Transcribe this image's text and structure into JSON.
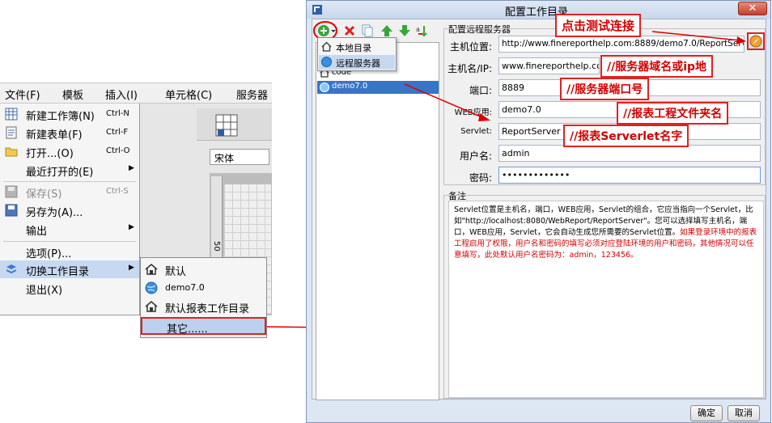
{
  "menubar": {
    "items": [
      {
        "label": "文件(F)"
      },
      {
        "label": "模板"
      },
      {
        "label": "插入(I)"
      },
      {
        "label": "单元格(C)"
      },
      {
        "label": "服务器"
      }
    ]
  },
  "file_menu": {
    "items": [
      {
        "label": "新建工作簿(N)",
        "shortcut": "Ctrl-N",
        "icon": "new-workbook-icon"
      },
      {
        "label": "新建表单(F)",
        "shortcut": "Ctrl-F",
        "icon": "new-form-icon"
      },
      {
        "label": "打开...(O)",
        "shortcut": "Ctrl-O",
        "icon": "folder-icon"
      },
      {
        "label": "最近打开的(E)",
        "shortcut": "",
        "icon": ""
      },
      {
        "label": "保存(S)",
        "shortcut": "Ctrl-S",
        "icon": "save-icon"
      },
      {
        "label": "另存为(A)...",
        "shortcut": "",
        "icon": "save-as-icon"
      },
      {
        "label": "输出",
        "shortcut": "",
        "icon": ""
      },
      {
        "label": "选项(P)...",
        "shortcut": "",
        "icon": ""
      },
      {
        "label": "切换工作目录",
        "shortcut": "",
        "icon": "switch-directory-icon"
      },
      {
        "label": "退出(X)",
        "shortcut": "",
        "icon": ""
      }
    ]
  },
  "editor": {
    "font_value": "宋体",
    "ruler_label": "50"
  },
  "switch_submenu": {
    "items": [
      {
        "label": "默认",
        "icon": "home-icon"
      },
      {
        "label": "demo7.0",
        "icon": "globe-icon"
      },
      {
        "label": "默认报表工作目录",
        "icon": "home-icon"
      },
      {
        "label": "其它......",
        "icon": ""
      }
    ]
  },
  "dialog": {
    "title": "配置工作目录",
    "add_dropdown": [
      {
        "label": "本地目录",
        "icon": "home-icon"
      },
      {
        "label": "远程服务器",
        "icon": "globe-icon"
      }
    ],
    "tree": [
      {
        "label": "code",
        "icon": "home-icon"
      },
      {
        "label": "demo7.0",
        "icon": "globe-icon"
      }
    ],
    "group_title": "配置远程服务器",
    "fields": {
      "host_position": {
        "label": "主机位置:",
        "value": "http://www.finereporthelp.com:8889/demo7.0/ReportServer"
      },
      "host_name": {
        "label": "主机名/IP:",
        "value": "www.finereporthelp.com"
      },
      "port": {
        "label": "端口:",
        "value": "8889"
      },
      "web_app": {
        "label": "WEB应用:",
        "value": "demo7.0"
      },
      "servlet": {
        "label": "Servlet:",
        "value": "ReportServer"
      },
      "username": {
        "label": "用户名:",
        "value": "admin"
      },
      "password": {
        "label": "密码:",
        "value": "•••••••••••••"
      }
    },
    "remarks_title": "备注",
    "remarks_black": "Servlet位置是主机名，端口，WEB应用，Servlet的组合，它应当指向一个Servlet，比如\"http://localhost:8080/WebReport/ReportServer\"。您可以选择填写主机名，端口，WEB应用，Servlet，它会自动生成您所需要的Servlet位置。",
    "remarks_red": "如果登录环境中的报表工程启用了权限，用户名和密码的填写必须对应登陆环境的用户和密码，其他情况可以任意填写，此处默认用户名密码为：admin，123456。",
    "ok_label": "确定",
    "cancel_label": "取消"
  },
  "annotations": {
    "test_connection": "点击测试连接",
    "server_domain": "//服务器域名或ip地",
    "server_port": "//服务器端口号",
    "project_folder": "//报表工程文件夹名",
    "servlet_name": "//报表Serverlet名字"
  },
  "colors": {
    "annotation_red": "#d20000",
    "selection_blue": "#3874c8",
    "dialog_bg": "#dde6f3"
  }
}
